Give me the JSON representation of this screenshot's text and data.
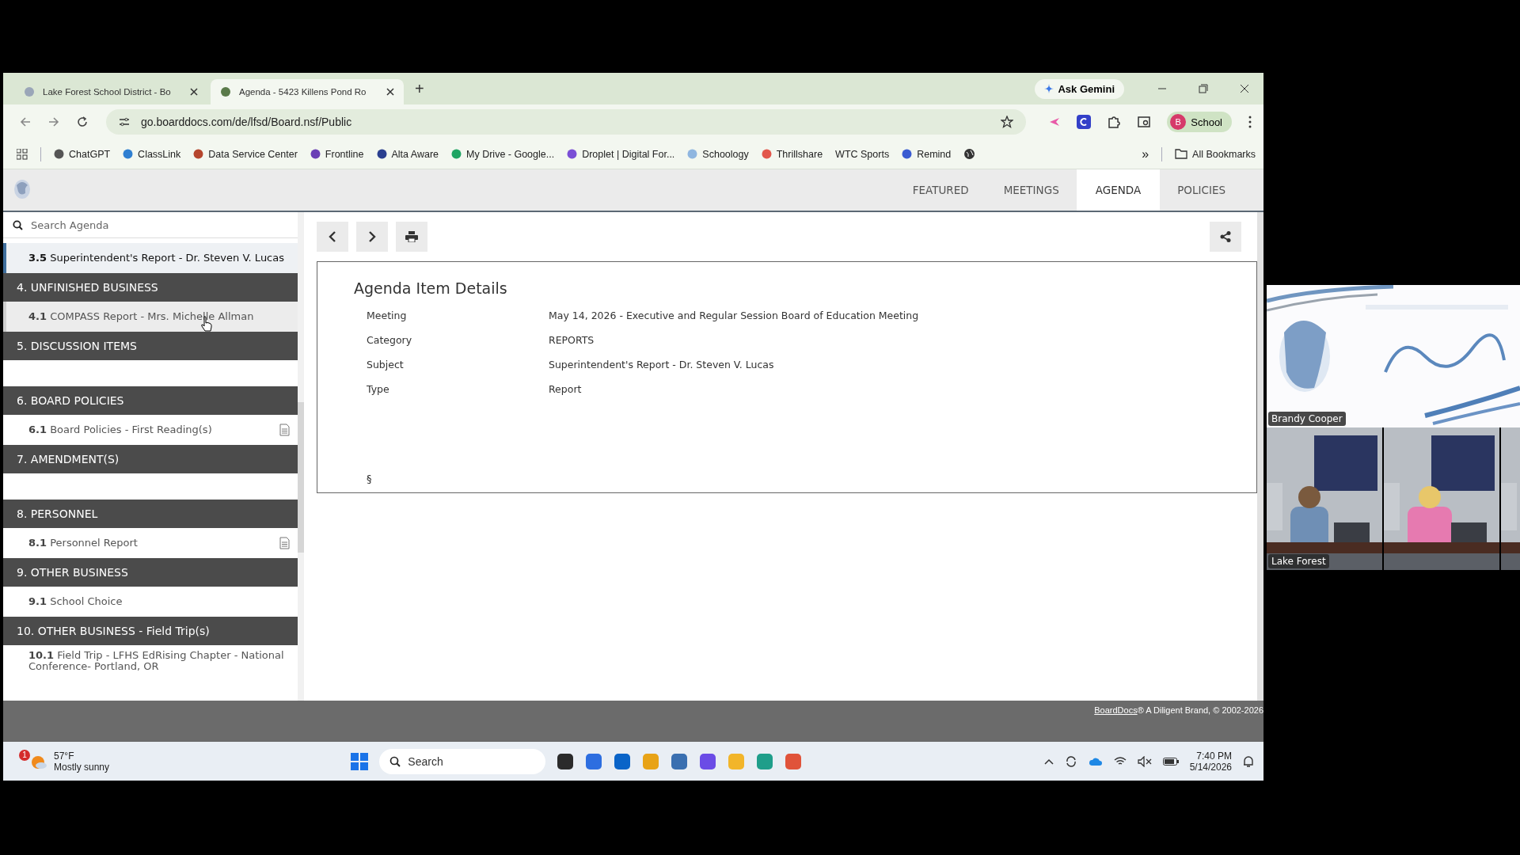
{
  "browser": {
    "tabs": [
      {
        "title": "Lake Forest School District - Bo",
        "selected": false
      },
      {
        "title": "Agenda - 5423 Killens Pond Ro",
        "selected": true
      }
    ],
    "new_tab": "+",
    "ask_gemini": "Ask Gemini",
    "url": "go.boarddocs.com/de/lfsd/Board.nsf/Public",
    "profile": {
      "initial": "B",
      "name": "School"
    },
    "bookmarks": [
      {
        "title": "ChatGPT",
        "color": "#555555"
      },
      {
        "title": "ClassLink",
        "color": "#2f7fd1"
      },
      {
        "title": "Data Service Center",
        "color": "#b5462e"
      },
      {
        "title": "Frontline",
        "color": "#6a3fb5"
      },
      {
        "title": "Alta Aware",
        "color": "#2a3f8f"
      },
      {
        "title": "My Drive - Google...",
        "color": "#1fa463"
      },
      {
        "title": "Droplet | Digital For...",
        "color": "#7a4fd6"
      },
      {
        "title": "Schoology",
        "color": "#8fb6e0"
      },
      {
        "title": "Thrillshare",
        "color": "#e2574c"
      },
      {
        "title": "WTC Sports"
      },
      {
        "title": "Remind",
        "color": "#3a5bd1"
      }
    ],
    "more": "»",
    "all_bookmarks": "All Bookmarks"
  },
  "page": {
    "nav": [
      {
        "label": "FEATURED",
        "selected": false
      },
      {
        "label": "MEETINGS",
        "selected": false
      },
      {
        "label": "AGENDA",
        "selected": true
      },
      {
        "label": "POLICIES",
        "selected": false
      }
    ],
    "search": {
      "placeholder": "Search Agenda"
    },
    "agenda": [
      {
        "kind": "item",
        "text": "**3.5** Superintendent's Report - Dr. Steven V. Lucas",
        "selected": true,
        "hovered": false,
        "attachment": false
      },
      {
        "kind": "section",
        "title": "4. UNFINISHED BUSINESS",
        "children": [
          {
            "kind": "item",
            "text": "**4.1** COMPASS Report - Mrs. Michelle Allman",
            "selected": false,
            "hovered": true,
            "attachment": false
          }
        ]
      },
      {
        "kind": "section",
        "title": "5. DISCUSSION ITEMS"
      },
      {
        "kind": "section",
        "title": "6. BOARD POLICIES",
        "children": [
          {
            "kind": "item",
            "text": "**6.1** Board Policies - First Reading(s)",
            "selected": false,
            "hovered": false,
            "attachment": true
          }
        ]
      },
      {
        "kind": "section",
        "title": "7. AMENDMENT(S)"
      },
      {
        "kind": "section",
        "title": "8. PERSONNEL",
        "children": [
          {
            "kind": "item",
            "text": "**8.1** Personnel Report",
            "selected": false,
            "hovered": false,
            "attachment": true
          }
        ]
      },
      {
        "kind": "section",
        "title": "9. OTHER BUSINESS",
        "children": [
          {
            "kind": "item",
            "text": "**9.1** School Choice",
            "selected": false,
            "hovered": false,
            "attachment": false
          }
        ]
      },
      {
        "kind": "section",
        "title": "10. OTHER BUSINESS - Field Trip(s)",
        "children": [
          {
            "kind": "item",
            "text": "**10.1** Field Trip - LFHS EdRising Chapter - National Conference- Portland, OR",
            "selected": false,
            "hovered": false,
            "attachment": false
          }
        ]
      }
    ],
    "details": {
      "title": "Agenda Item Details",
      "fields": [
        {
          "label": "Meeting",
          "value": "May 14, 2026 - Executive and Regular Session Board of Education Meeting"
        },
        {
          "label": "Category",
          "value": "REPORTS"
        },
        {
          "label": "Subject",
          "value": "Superintendent's Report - Dr. Steven V. Lucas"
        },
        {
          "label": "Type",
          "value": "Report"
        }
      ],
      "section_mark": "§"
    },
    "footer": {
      "link": "BoardDocs",
      "text": "® A Diligent Brand, © 2002-2026"
    }
  },
  "taskbar": {
    "weather": {
      "badge": "1",
      "temp": "57°F",
      "condition": "Mostly sunny"
    },
    "search": {
      "placeholder": "Search"
    },
    "time": "7:40 PM",
    "date": "5/14/2026"
  },
  "video": {
    "tiles": [
      {
        "kind": "slide",
        "name": "Brandy Cooper"
      },
      {
        "kind": "room",
        "name": "Lake Forest"
      },
      {
        "kind": "room"
      },
      {
        "kind": "room"
      }
    ]
  }
}
